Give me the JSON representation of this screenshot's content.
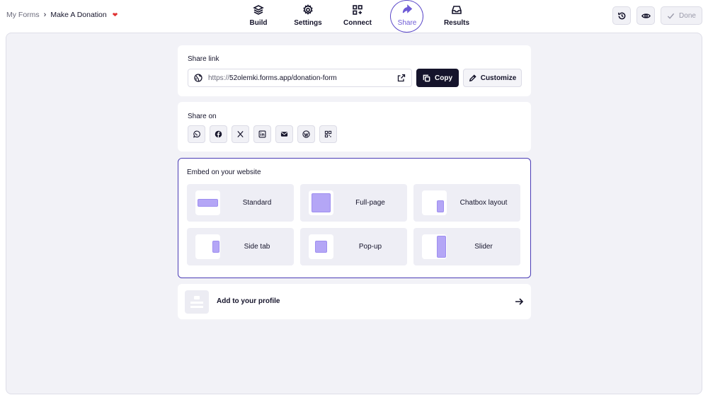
{
  "breadcrumb": {
    "parent": "My Forms",
    "separator": "›",
    "current": "Make A Donation",
    "emoji": "❤"
  },
  "nav": {
    "items": [
      {
        "label": "Build",
        "icon": "layers-icon"
      },
      {
        "label": "Settings",
        "icon": "gear-icon"
      },
      {
        "label": "Connect",
        "icon": "apps-plus-icon"
      },
      {
        "label": "Share",
        "icon": "share-arrow-icon",
        "active": true
      },
      {
        "label": "Results",
        "icon": "inbox-icon"
      }
    ]
  },
  "toolbar": {
    "history_icon": "history-icon",
    "preview_icon": "eye-icon",
    "done_label": "Done"
  },
  "share_link": {
    "title": "Share link",
    "url_prefix": "https://",
    "url_rest": "52olemki.forms.app/donation-form",
    "copy_label": "Copy",
    "customize_label": "Customize"
  },
  "share_on": {
    "title": "Share on",
    "channels": [
      "whatsapp-icon",
      "facebook-icon",
      "x-icon",
      "linkedin-icon",
      "email-icon",
      "wordpress-icon",
      "qr-code-icon"
    ]
  },
  "embed": {
    "title": "Embed on your website",
    "options": [
      {
        "label": "Standard"
      },
      {
        "label": "Full-page"
      },
      {
        "label": "Chatbox layout"
      },
      {
        "label": "Side tab"
      },
      {
        "label": "Pop-up"
      },
      {
        "label": "Slider"
      }
    ]
  },
  "profile": {
    "label": "Add to your profile"
  },
  "colors": {
    "accent": "#6e5bd6",
    "dark": "#15142b",
    "shape_fill": "#b4a6f6",
    "canvas_bg": "#f2f2f7"
  }
}
